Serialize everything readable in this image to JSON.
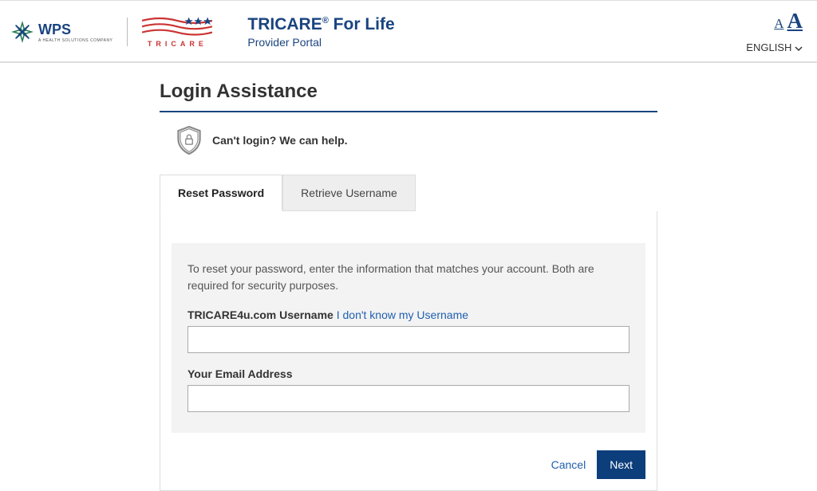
{
  "header": {
    "wps_name": "WPS",
    "wps_sub": "A HEALTH SOLUTIONS COMPANY",
    "tricare_brand": "TRICARE",
    "portal_title_main1": "TRICARE",
    "portal_title_reg": "®",
    "portal_title_main2": " For Life",
    "portal_subtitle": "Provider Portal",
    "font_small": "A",
    "font_large": "A",
    "language": "ENGLISH"
  },
  "page": {
    "title": "Login Assistance",
    "help_text": "Can't login? We can help."
  },
  "tabs": {
    "reset": "Reset Password",
    "retrieve": "Retrieve Username"
  },
  "form": {
    "description": "To reset your password, enter the information that matches your account. Both are required for security purposes.",
    "username_label": "TRICARE4u.com Username",
    "username_link": " I don't know my Username",
    "email_label": "Your Email Address"
  },
  "actions": {
    "cancel": "Cancel",
    "next": "Next"
  }
}
